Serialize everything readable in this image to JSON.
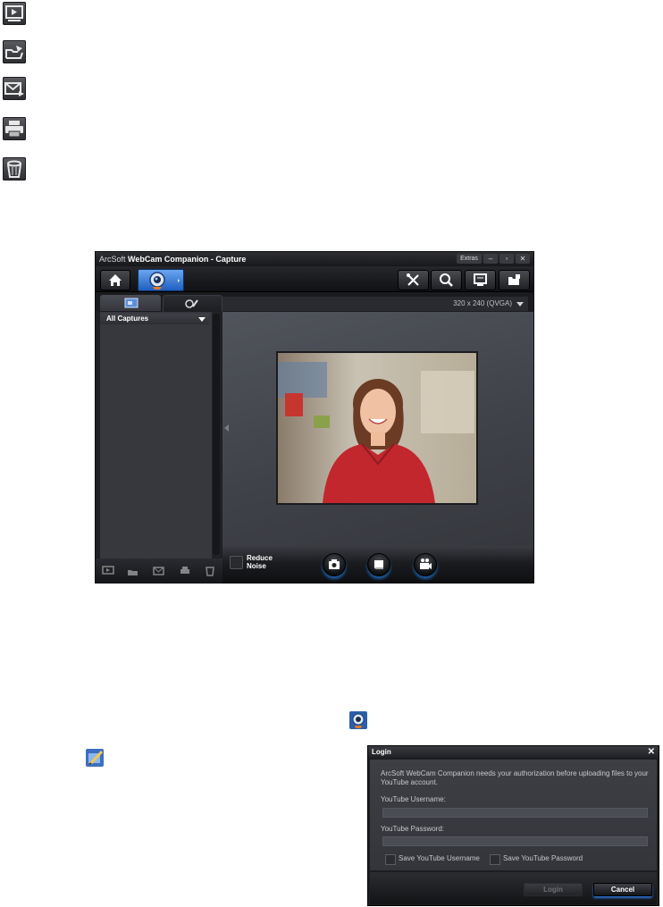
{
  "window": {
    "brand_small": "ArcSoft",
    "brand_bold": "WebCam Companion",
    "title_suffix": " - Capture",
    "extras_label": "Extras",
    "minimize_label": "–",
    "maximize_label": "▫",
    "close_label": "✕"
  },
  "capture": {
    "resolution": "320 x 240 (QVGA)",
    "album_filter": "All Captures",
    "reduce_noise": "Reduce Noise"
  },
  "login": {
    "title": "Login",
    "close_label": "✕",
    "message": "ArcSoft WebCam Companion needs your authorization before uploading files to your YouTube account.",
    "username_label": "YouTube Username:",
    "password_label": "YouTube Password:",
    "save_username": "Save YouTube Username",
    "save_password": "Save YouTube Password",
    "login_button": "Login",
    "cancel_button": "Cancel"
  },
  "colors": {
    "window_bg": "#1f2024",
    "accent_blue": "#2d6fd1",
    "panel": "#36383e"
  },
  "icons": [
    "play-video-icon",
    "share-icon",
    "email-icon",
    "print-icon",
    "trash-icon",
    "home-icon",
    "webcam-icon",
    "tools-icon",
    "search-icon",
    "monitor-icon",
    "folder-icon",
    "camera-icon",
    "stop-icon",
    "video-camera-icon",
    "edit-icon"
  ]
}
